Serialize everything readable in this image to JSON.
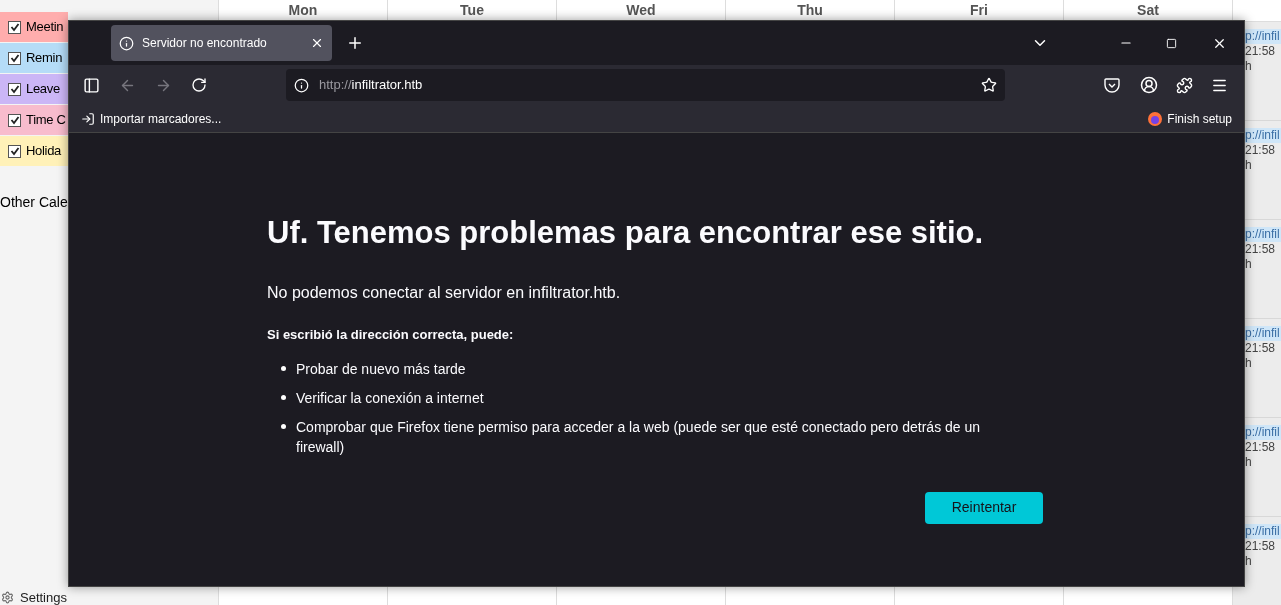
{
  "calendar": {
    "days": [
      "Mon",
      "Tue",
      "Wed",
      "Thu",
      "Fri",
      "Sat"
    ],
    "categories": [
      {
        "label": "Meetin",
        "color": "#ffadad",
        "checked": true
      },
      {
        "label": "Remin",
        "color": "#b5dcf7",
        "checked": true
      },
      {
        "label": "Leave",
        "color": "#cbb6f6",
        "checked": true
      },
      {
        "label": "Time C",
        "color": "#f8bccd",
        "checked": true
      },
      {
        "label": "Holida",
        "color": "#fff1b8",
        "checked": true
      }
    ],
    "other_calendars": "Other Cale",
    "settings": "Settings",
    "events": [
      {
        "link": "p://infil",
        "time": "21:58 h"
      },
      {
        "link": "p://infil",
        "time": "21:58 h"
      },
      {
        "link": "p://infil",
        "time": "21:58 h"
      },
      {
        "link": "p://infil",
        "time": "21:58 h"
      },
      {
        "link": "p://infil",
        "time": "21:58 h"
      },
      {
        "link": "p://infil",
        "time": "21:58 h"
      }
    ]
  },
  "browser": {
    "tabs": [
      {
        "title": "Servidor no encontrado",
        "selected": true
      }
    ],
    "url_scheme": "http://",
    "url_host": "infiltrator.htb",
    "bookmarks": [
      {
        "label": "Importar marcadores..."
      }
    ],
    "finish_setup": "Finish setup",
    "error": {
      "title": "Uf. Tenemos problemas para encontrar ese sitio.",
      "message": "No podemos conectar al servidor en infiltrator.htb.",
      "hint": "Si escribió la dirección correcta, puede:",
      "tips": [
        "Probar de nuevo más tarde",
        "Verificar la conexión a internet",
        "Comprobar que Firefox tiene permiso para acceder a la web (puede ser que esté conectado pero detrás de un firewall)"
      ],
      "button": "Reintentar"
    }
  }
}
